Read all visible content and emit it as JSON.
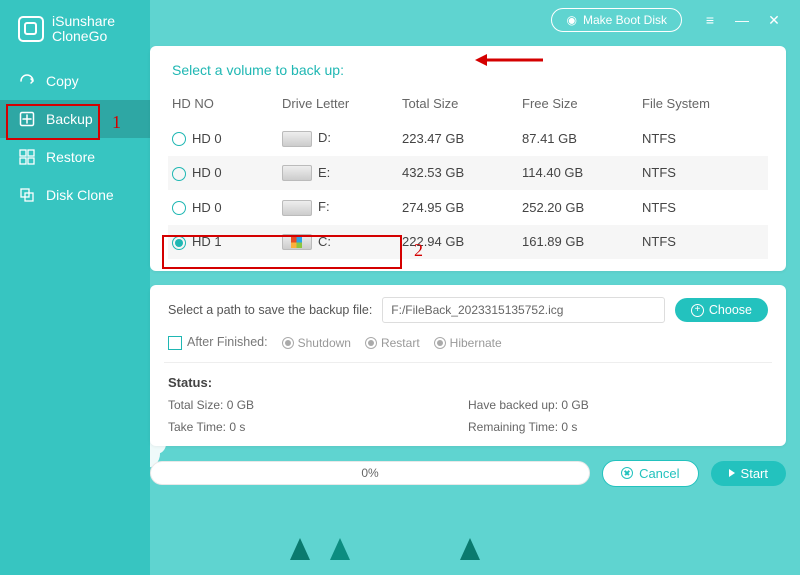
{
  "app": {
    "name_line1": "iSunshare",
    "name_line2": "CloneGo"
  },
  "titlebar": {
    "boot_label": "Make Boot Disk"
  },
  "sidebar": {
    "items": [
      {
        "label": "Copy"
      },
      {
        "label": "Backup"
      },
      {
        "label": "Restore"
      },
      {
        "label": "Disk Clone"
      }
    ]
  },
  "section": {
    "title": "Select a volume to back up:"
  },
  "table": {
    "headers": {
      "hdno": "HD NO",
      "drive": "Drive Letter",
      "total": "Total Size",
      "free": "Free Size",
      "fs": "File System"
    },
    "rows": [
      {
        "hd": "HD 0",
        "letter": "D:",
        "total": "223.47 GB",
        "free": "87.41 GB",
        "fs": "NTFS",
        "selected": false,
        "win": false
      },
      {
        "hd": "HD 0",
        "letter": "E:",
        "total": "432.53 GB",
        "free": "114.40 GB",
        "fs": "NTFS",
        "selected": false,
        "win": false
      },
      {
        "hd": "HD 0",
        "letter": "F:",
        "total": "274.95 GB",
        "free": "252.20 GB",
        "fs": "NTFS",
        "selected": false,
        "win": false
      },
      {
        "hd": "HD 1",
        "letter": "C:",
        "total": "222.94 GB",
        "free": "161.89 GB",
        "fs": "NTFS",
        "selected": true,
        "win": true
      }
    ]
  },
  "path": {
    "label": "Select a path to save the backup file:",
    "value": "F:/FileBack_2023315135752.icg",
    "choose": "Choose"
  },
  "after": {
    "label": "After Finished:",
    "opts": [
      "Shutdown",
      "Restart",
      "Hibernate"
    ]
  },
  "status": {
    "title": "Status:",
    "total": "Total Size: 0 GB",
    "backed": "Have backed up: 0 GB",
    "time": "Take Time: 0 s",
    "remain": "Remaining Time: 0 s"
  },
  "bottom": {
    "progress": "0%",
    "cancel": "Cancel",
    "start": "Start"
  },
  "annotations": {
    "num1": "1",
    "num2": "2"
  }
}
